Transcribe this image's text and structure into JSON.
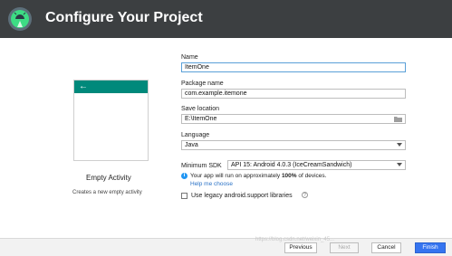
{
  "header": {
    "title": "Configure Your Project",
    "logo": "android-studio-icon"
  },
  "template": {
    "name": "Empty Activity",
    "description": "Creates a new empty activity",
    "icon": "back-arrow-icon"
  },
  "form": {
    "name_label": "Name",
    "name_value": "ItemOne",
    "package_label": "Package name",
    "package_value": "com.example.itemone",
    "location_label": "Save location",
    "location_value": "E:\\ItemOne",
    "language_label": "Language",
    "language_value": "Java",
    "minsdk_label": "Minimum SDK",
    "minsdk_value": "API 15: Android 4.0.3 (IceCreamSandwich)",
    "info_pre": "Your app will run on approximately ",
    "info_bold": "100%",
    "info_post": " of devices.",
    "help_link": "Help me choose",
    "legacy_label": "Use legacy android.support libraries",
    "legacy_checked": false
  },
  "footer": {
    "previous": "Previous",
    "next": "Next",
    "cancel": "Cancel",
    "finish": "Finish"
  },
  "colors": {
    "header_bg": "#3c3f41",
    "accent": "#00897b",
    "primary_button": "#3574f0",
    "focus_border": "#5aa0d8"
  },
  "watermark": "https://blog.csdn.net/weixin_45..."
}
